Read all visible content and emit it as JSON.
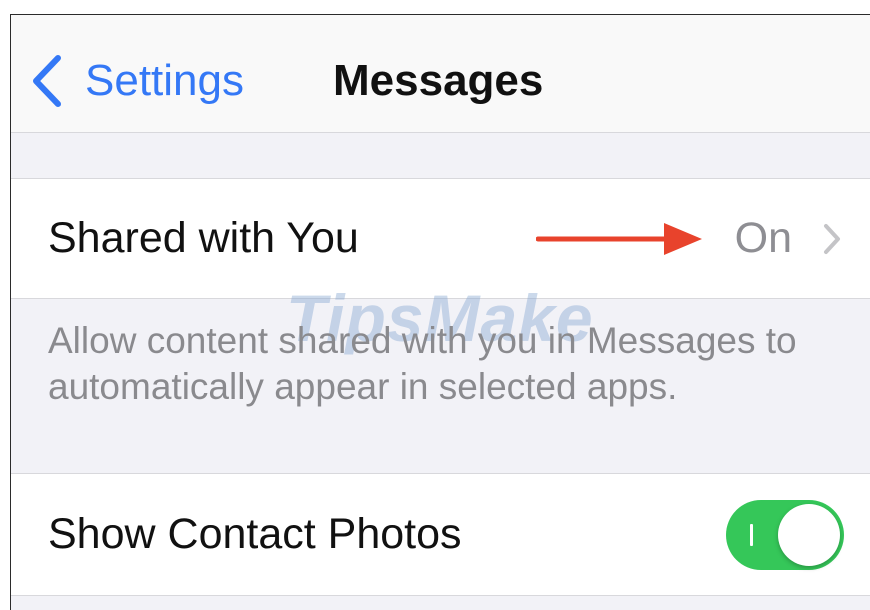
{
  "colors": {
    "accent": "#3478f6",
    "toggle_on": "#35c759",
    "arrow": "#e8432c",
    "secondary_text": "#8e8e93"
  },
  "navbar": {
    "back_label": "Settings",
    "back_icon": "chevron-left-icon",
    "title": "Messages"
  },
  "shared_with_you": {
    "label": "Shared with You",
    "value": "On",
    "chevron_icon": "chevron-right-icon",
    "annotation_icon": "red-arrow-icon"
  },
  "footer_text": "Allow content shared with you in Messages to automatically appear in selected apps.",
  "watermark": "TipsMake",
  "contact_photos": {
    "label": "Show Contact Photos",
    "toggle_on": true
  }
}
